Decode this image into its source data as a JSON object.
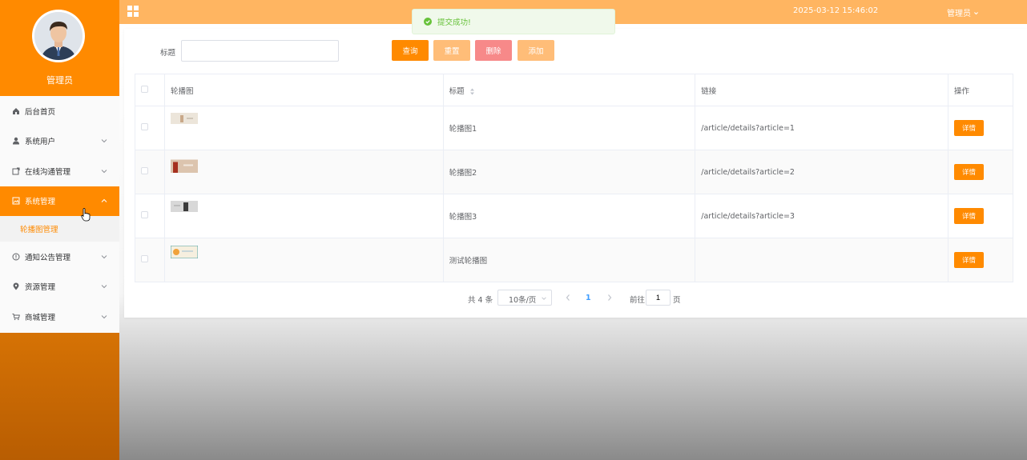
{
  "sidebar": {
    "user_name": "管理员",
    "items": [
      {
        "label": "后台首页",
        "icon": "home-icon"
      },
      {
        "label": "系统用户",
        "icon": "user-icon"
      },
      {
        "label": "在线沟通管理",
        "icon": "chat-icon"
      },
      {
        "label": "系统管理",
        "icon": "picture-icon"
      },
      {
        "label": "通知公告管理",
        "icon": "info-icon"
      },
      {
        "label": "资源管理",
        "icon": "location-icon"
      },
      {
        "label": "商城管理",
        "icon": "cart-icon"
      }
    ],
    "submenu_label": "轮播图管理"
  },
  "topbar": {
    "datetime": "2025-03-12 15:46:02",
    "user": "管理员"
  },
  "toast": {
    "message": "提交成功!"
  },
  "search": {
    "label": "标题",
    "value": "",
    "query_label": "查询",
    "reset_label": "重置",
    "delete_label": "删除",
    "add_label": "添加"
  },
  "table": {
    "headers": [
      "轮播图",
      "标题",
      "链接",
      "操作"
    ],
    "rows": [
      {
        "title": "轮播图1",
        "link": "/article/details?article=1",
        "action": "详情",
        "thumb_color": "#e9e2d8"
      },
      {
        "title": "轮播图2",
        "link": "/article/details?article=2",
        "action": "详情",
        "thumb_color": "#d9b99c"
      },
      {
        "title": "轮播图3",
        "link": "/article/details?article=3",
        "action": "详情",
        "thumb_color": "#d6d6d6"
      },
      {
        "title": "测试轮播图",
        "link": "",
        "action": "详情",
        "thumb_color": "#f3ead6"
      }
    ]
  },
  "pagination": {
    "total": "共 4 条",
    "page_size": "10条/页",
    "current_page": "1",
    "goto_label": "前往",
    "goto_value": "1",
    "page_suffix": "页"
  },
  "colors": {
    "primary": "#ff8a00",
    "topbar": "#ffb561",
    "success": "#67c23a",
    "danger": "#f78989"
  }
}
